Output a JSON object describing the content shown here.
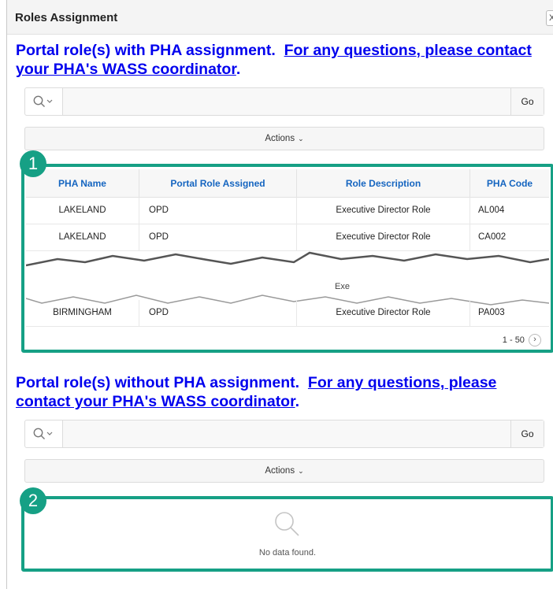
{
  "dialog": {
    "title": "Roles Assignment",
    "close_label": "X"
  },
  "section1": {
    "heading_lead": "Portal role(s) with PHA assignment.",
    "heading_link": "For any questions, please contact your PHA's WASS coordinator",
    "search": {
      "value": "",
      "go_label": "Go"
    },
    "actions_label": "Actions",
    "callout_number": "1",
    "columns": [
      "PHA Name",
      "Portal Role Assigned",
      "Role Description",
      "PHA Code"
    ],
    "rows": [
      [
        "LAKELAND",
        "OPD",
        "Executive Director Role",
        "AL004"
      ],
      [
        "LAKELAND",
        "OPD",
        "Executive Director Role",
        "CA002"
      ],
      [
        "BIRMINGHAM",
        "OPD",
        "Executive Director Role",
        "PA003"
      ]
    ],
    "torn_fragment": "Exe",
    "pagination": "1 - 50"
  },
  "section2": {
    "heading_lead": "Portal role(s) without PHA assignment.",
    "heading_link": "For any questions, please contact your PHA's WASS coordinator",
    "search": {
      "value": "",
      "go_label": "Go"
    },
    "actions_label": "Actions",
    "callout_number": "2",
    "empty_message": "No data found."
  },
  "colors": {
    "link": "#0000ee",
    "callout": "#16a085",
    "header_text": "#1565c0"
  },
  "icons": [
    "search-icon",
    "chevron-down-icon",
    "chevron-right-icon",
    "close-icon"
  ]
}
